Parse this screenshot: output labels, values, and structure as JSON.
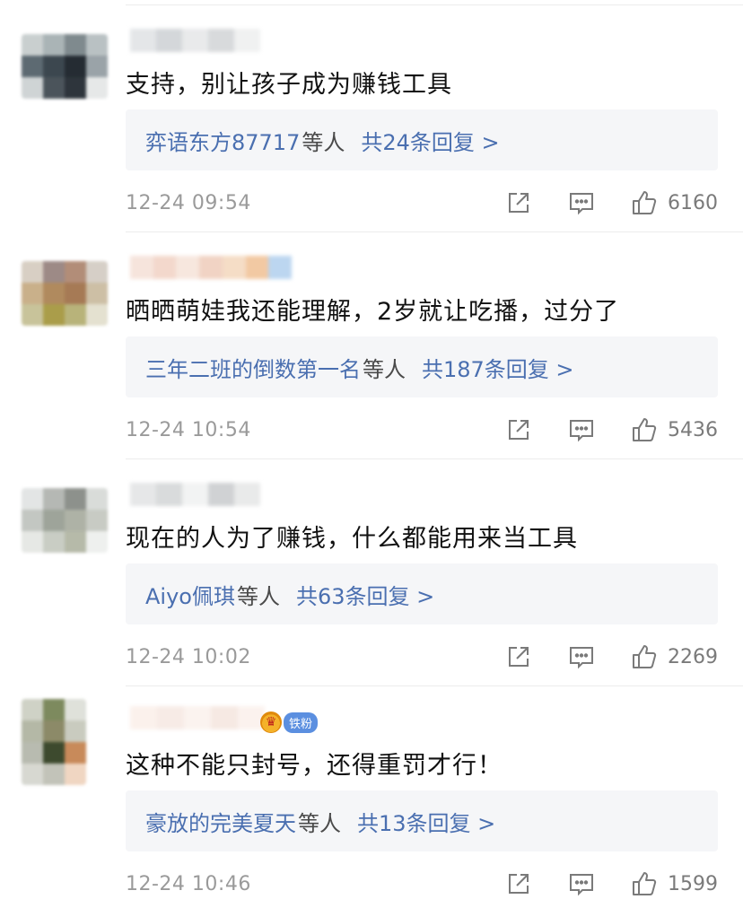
{
  "comments": [
    {
      "text": "支持，别让孩子成为赚钱工具",
      "reply_users": "弈语东方87717",
      "reply_suffix": "等人",
      "reply_total": "共24条回复 >",
      "time": "12-24 09:54",
      "likes": "6160"
    },
    {
      "text": "晒晒萌娃我还能理解，2岁就让吃播，过分了",
      "reply_users": "三年二班的倒数第一名",
      "reply_suffix": "等人",
      "reply_total": "共187条回复 >",
      "time": "12-24 10:54",
      "likes": "5436"
    },
    {
      "text": "现在的人为了赚钱，什么都能用来当工具",
      "reply_users": "Aiyo佩琪",
      "reply_suffix": "等人",
      "reply_total": "共63条回复 >",
      "time": "12-24 10:02",
      "likes": "2269"
    },
    {
      "text": "这种不能只封号，还得重罚才行！",
      "reply_users": "豪放的完美夏天",
      "reply_suffix": "等人",
      "reply_total": "共13条回复 >",
      "time": "12-24 10:46",
      "likes": "1599",
      "badge_label": "铁粉"
    }
  ],
  "icons": {
    "share": "share-icon",
    "comment": "comment-icon",
    "like": "thumbs-up-icon",
    "badge": "crown-icon"
  },
  "colors": {
    "link": "#4a6fb0",
    "reply_bg": "#f5f6f8",
    "meta": "#9a9a9a",
    "badge": "#5b8fe0"
  }
}
